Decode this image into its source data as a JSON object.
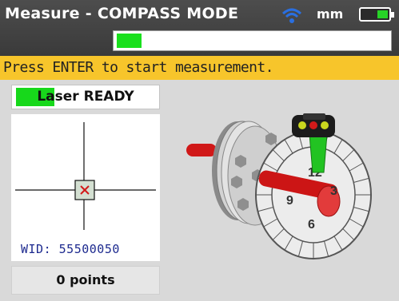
{
  "header": {
    "title": "Measure - COMPASS MODE",
    "units": "mm",
    "wifi_icon": "wifi-icon",
    "battery_icon": "battery-icon",
    "progress_fraction": 0.09
  },
  "instruction": "Press ENTER to start measurement.",
  "laser": {
    "label": "Laser READY",
    "led_color": "#17d81b"
  },
  "target": {
    "wid_label": "WID: 55500050"
  },
  "points_label": "0 points",
  "compass": {
    "labels": [
      "12",
      "3",
      "6",
      "9"
    ]
  },
  "colors": {
    "header_bg": "#3f3f3f",
    "banner": "#f7c52b",
    "ready_green": "#17d81b",
    "rod_red": "#d01818"
  }
}
